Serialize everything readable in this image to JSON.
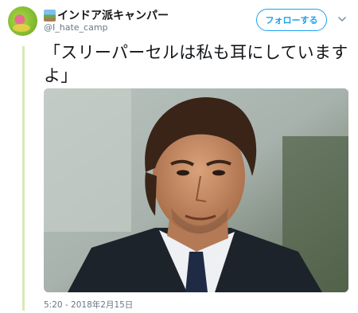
{
  "tweet": {
    "display_name": "インドア派キャンパー",
    "handle": "@I_hate_camp",
    "text": "「スリーパーセルは私も耳にしていますよ」",
    "timestamp": "5:20 - 2018年2月15日"
  },
  "actions": {
    "follow_label": "フォローする"
  },
  "icons": {
    "avatar": "avatar-image",
    "name_emoji": "house-landscape-emoji",
    "menu": "chevron-down-icon"
  },
  "colors": {
    "accent": "#1da1f2",
    "text": "#14171a",
    "muted": "#657786",
    "thread_line": "#d7eab5"
  }
}
